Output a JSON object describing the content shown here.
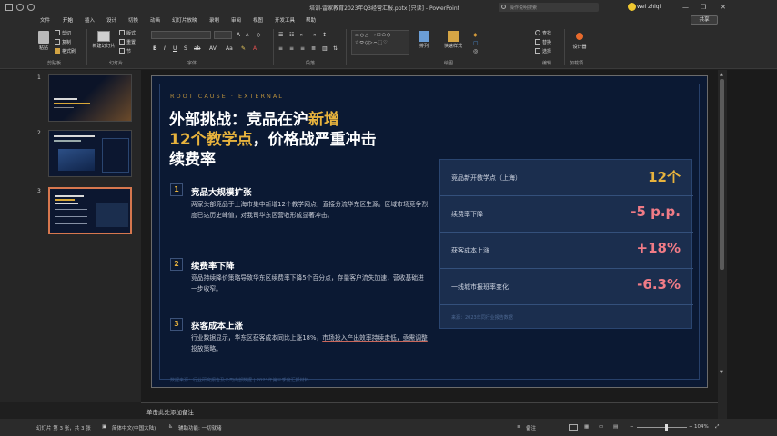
{
  "window": {
    "doc_title": "培训-雷家教育2023年Q3经营汇报.pptx [只读] - PowerPoint",
    "search_placeholder": "操作说明搜索",
    "user_name": "wei zhiqi",
    "share_label": "共享"
  },
  "tabs": [
    "文件",
    "开始",
    "插入",
    "设计",
    "切换",
    "动画",
    "幻灯片放映",
    "录制",
    "审阅",
    "视图",
    "开发工具",
    "帮助"
  ],
  "active_tab": "开始",
  "ribbon": {
    "paste": "粘贴",
    "cut": "剪切",
    "copy": "复制",
    "format_painter": "格式刷",
    "new_slide": "新建幻灯片",
    "layout": "版式",
    "reset": "重置",
    "section": "节",
    "arrange": "排列",
    "quick_styles": "快速样式",
    "find": "查找",
    "replace": "替换",
    "select": "选择",
    "designer": "设计器",
    "groups": {
      "clipboard": "剪贴板",
      "slides": "幻灯片",
      "font": "字体",
      "paragraph": "段落",
      "drawing": "绘图",
      "editing": "编辑",
      "designer": "加载项"
    }
  },
  "thumbnails": [
    {
      "num": "1",
      "title": "雷家教育 Q3 经营分析与 Q4 策略"
    },
    {
      "num": "2",
      "title": "华东区营收达成 Q3 营收"
    },
    {
      "num": "3",
      "title": "外部挑战：竞品在沪新增"
    }
  ],
  "slide": {
    "eyebrow": "ROOT CAUSE · EXTERNAL",
    "title_part1": "外部挑战：竞品在沪",
    "title_gold1": "新增",
    "title_gold2": "12个教学点",
    "title_part2": "，价格战严重冲击续费率",
    "items": [
      {
        "num": "1",
        "heading": "竞品大规模扩张",
        "body": "两家头部竞品于上海市集中新增12个教学网点，直接分流华东区生源。区域市场竞争烈度已达历史峰值，对我司华东区营收形成显著冲击。"
      },
      {
        "num": "2",
        "heading": "续费率下降",
        "body": "竞品持续降价策略导致华东区续费率下降5个百分点，存量客户流失加速，营收基础进一步收窄。"
      },
      {
        "num": "3",
        "heading": "获客成本上涨",
        "body_plain": "行业数据显示，华东区获客成本同比上涨18%，",
        "body_highlight": "市场投入产出效率持续走低，亟需调整投放策略。"
      }
    ],
    "kpis": [
      {
        "label": "竞品新开教学点（上海）",
        "value": "12个",
        "color": "#e8b33d"
      },
      {
        "label": "续费率下降",
        "value": "-5 p.p.",
        "color": "#f07b86"
      },
      {
        "label": "获客成本上涨",
        "value": "+18%",
        "color": "#f07b86"
      },
      {
        "label": "一线城市报班率变化",
        "value": "-6.3%",
        "color": "#f07b86"
      }
    ],
    "kpi_source": "来源：2023年同行业报告数据",
    "footer_note": "数据来源：行业研究报告及公司内部数据 | 2023年第三季度汇报材料"
  },
  "notes_placeholder": "单击此处添加备注",
  "status": {
    "slide_of": "幻灯片 第 3 张，共 3 张",
    "language": "简体中文(中国大陆)",
    "accessibility": "辅助功能: 一切就绪",
    "notes": "备注",
    "zoom": "104%"
  }
}
